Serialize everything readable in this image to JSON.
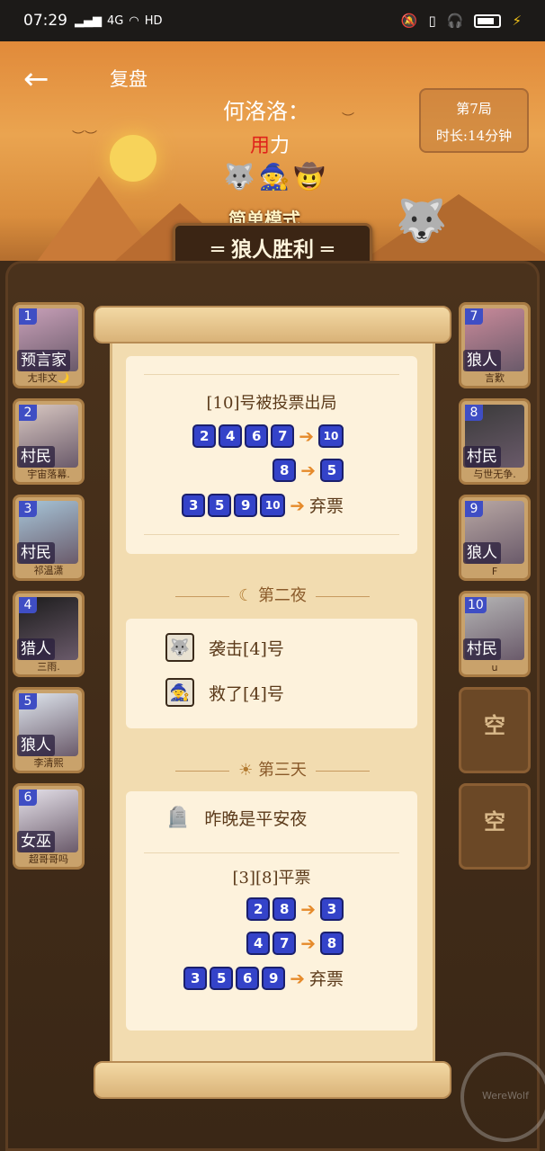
{
  "status_bar": {
    "time": "07:29",
    "network": "4G",
    "wifi_label": "HD"
  },
  "header": {
    "back_icon": "arrow-left-icon",
    "title": "复盘",
    "player_name": "何洛洛：",
    "player_sub_highlight": "用",
    "player_sub_rest": "力",
    "round": "第7局",
    "duration": "时长:14分钟",
    "mode": "简单模式",
    "result": "狼人胜利"
  },
  "players_left": [
    {
      "num": "1",
      "role": "预言家",
      "nick": "尢非文🌙",
      "color": "#c8a0b8"
    },
    {
      "num": "2",
      "role": "村民",
      "nick": "宇宙落幕.",
      "color": "#d9c8c2"
    },
    {
      "num": "3",
      "role": "村民",
      "nick": "祁温潇",
      "color": "#a7c6d9"
    },
    {
      "num": "4",
      "role": "猎人",
      "nick": "三雨.",
      "color": "#1c1c1c"
    },
    {
      "num": "5",
      "role": "狼人",
      "nick": "李清熙",
      "color": "#dfe6ee"
    },
    {
      "num": "6",
      "role": "女巫",
      "nick": "超哥哥吗",
      "color": "#e6e2ea"
    }
  ],
  "players_right": [
    {
      "num": "7",
      "role": "狼人",
      "nick": "言歎",
      "color": "#c98a9a"
    },
    {
      "num": "8",
      "role": "村民",
      "nick": "与世无争.",
      "color": "#3a3a3a"
    },
    {
      "num": "9",
      "role": "狼人",
      "nick": "F",
      "color": "#b9a8a4"
    },
    {
      "num": "10",
      "role": "村民",
      "nick": "u",
      "color": "#b5b5b5"
    }
  ],
  "empty_slots": [
    "空",
    "空"
  ],
  "day1": {
    "heading": "[10]号被投票出局",
    "votes": [
      {
        "voters": [
          "2",
          "4",
          "6",
          "7"
        ],
        "target": "10"
      },
      {
        "voters": [
          "8"
        ],
        "target": "5"
      },
      {
        "voters": [
          "3",
          "5",
          "9",
          "10"
        ],
        "target": "弃票"
      }
    ]
  },
  "night2": {
    "title": "第二夜",
    "icon": "moon-icon",
    "events": [
      {
        "icon": "wolf-icon",
        "text": "袭击[4]号"
      },
      {
        "icon": "witch-icon",
        "text": "救了[4]号"
      }
    ]
  },
  "day3": {
    "title": "第三天",
    "icon": "sun-icon",
    "peace": "昨晚是平安夜",
    "heading": "[3][8]平票",
    "votes": [
      {
        "voters": [
          "2",
          "8"
        ],
        "target": "3"
      },
      {
        "voters": [
          "4",
          "7"
        ],
        "target": "8"
      },
      {
        "voters": [
          "3",
          "5",
          "6",
          "9"
        ],
        "target": "弃票"
      }
    ]
  }
}
